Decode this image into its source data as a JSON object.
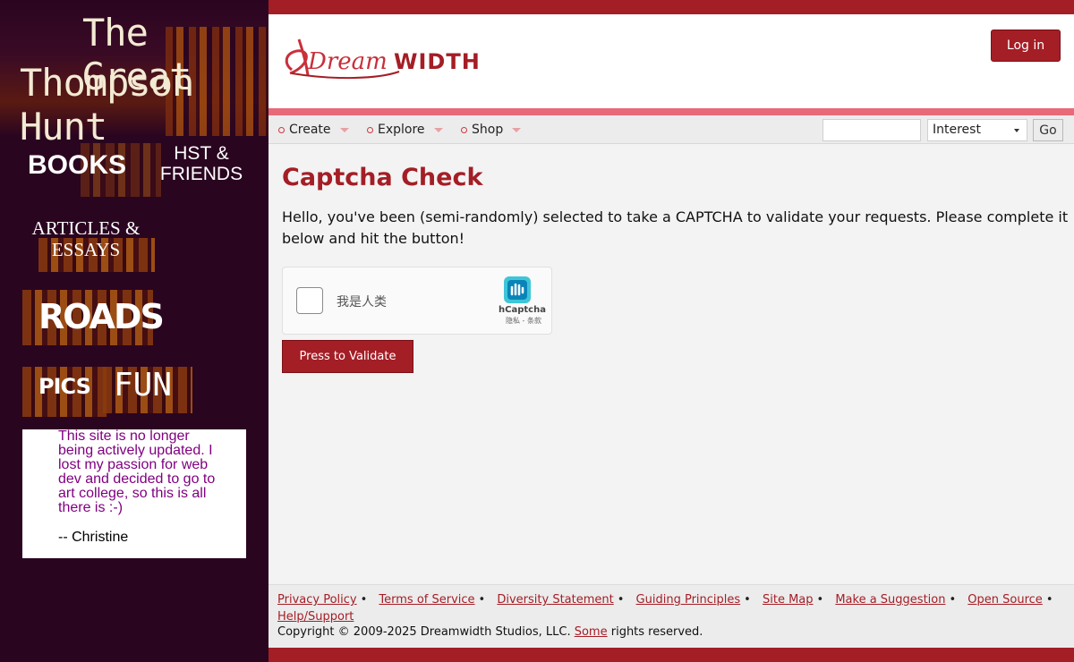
{
  "sidebar": {
    "title_line1": "The Great",
    "title_line2": "Thompson Hunt",
    "nav": {
      "books": "BOOKS",
      "hst_line1": "HST &",
      "hst_line2": "FRIENDS",
      "articles_line1": "ARTICLES &",
      "articles_line2": "ESSAYS",
      "roads": "ROADS",
      "pics": "PICS",
      "fun": "FUN"
    },
    "notice": "This site is no longer being actively updated. I lost my passion for web dev and decided to go to art college, so this is all there is :-)",
    "signature": "-- Christine"
  },
  "header": {
    "logo_part1": "Dream",
    "logo_part2": "WIDTH",
    "login_label": "Log in"
  },
  "nav": {
    "menus": [
      "Create",
      "Explore",
      "Shop"
    ],
    "search_placeholder": "",
    "search_type": "Interest",
    "go_label": "Go"
  },
  "main": {
    "heading": "Captcha Check",
    "paragraph": "Hello, you've been (semi-randomly) selected to take a CAPTCHA to validate your requests. Please complete it below and hit the button!",
    "captcha": {
      "checkbox_label": "我是人类",
      "brand": "hCaptcha",
      "links": "隐私 - 条款"
    },
    "validate_label": "Press to Validate"
  },
  "footer": {
    "links": [
      "Privacy Policy",
      "Terms of Service",
      "Diversity Statement",
      "Guiding Principles",
      "Site Map",
      "Make a Suggestion",
      "Open Source",
      "Help/Support"
    ],
    "copyright_prefix": "Copyright © 2009-2025 Dreamwidth Studios, LLC.",
    "copyright_link": "Some",
    "copyright_suffix": "rights reserved."
  },
  "colors": {
    "brand_red": "#a41e26",
    "sidebar_bg": "#2a0520",
    "notice_text": "#800080"
  }
}
